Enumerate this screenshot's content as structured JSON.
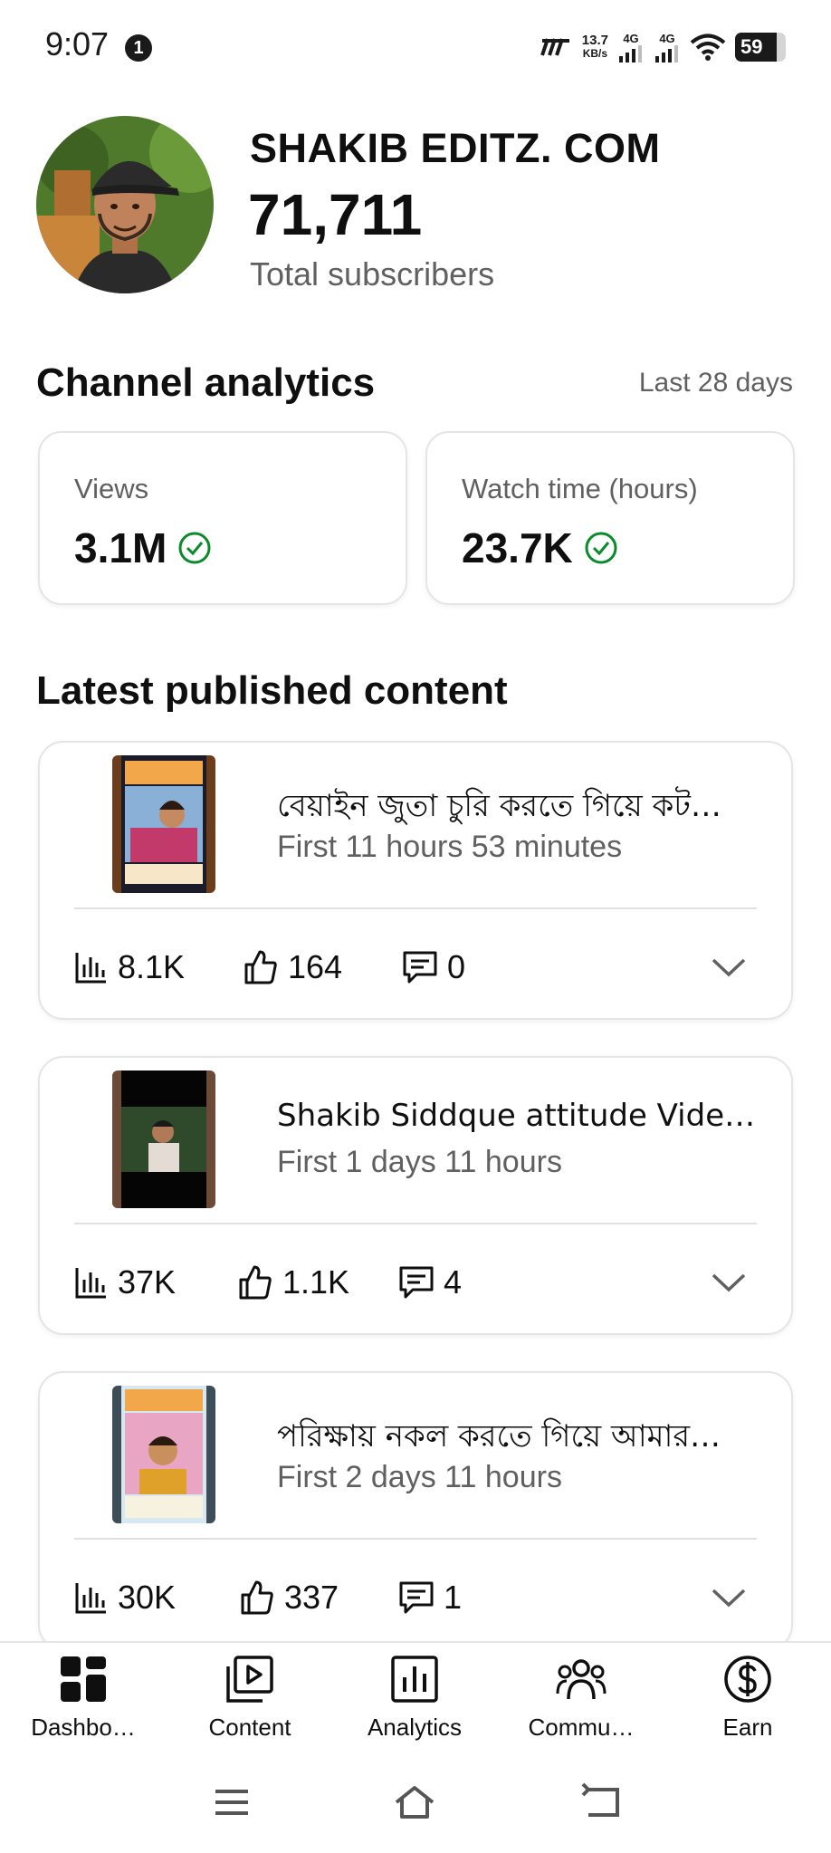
{
  "status_bar": {
    "time": "9:07",
    "notification_count": "1",
    "net_speed_value": "13.7",
    "net_speed_unit": "KB/s",
    "signal1_label": "4G",
    "signal2_label": "4G",
    "battery_level": "59"
  },
  "channel": {
    "name": "SHAKIB EDITZ. COM",
    "subscribers": "71,711",
    "subscribers_label": "Total subscribers"
  },
  "analytics": {
    "title": "Channel analytics",
    "range": "Last 28 days",
    "views_label": "Views",
    "views_value": "3.1M",
    "watch_label": "Watch time (hours)",
    "watch_value": "23.7K",
    "status_color": "#0a8a2a"
  },
  "latest": {
    "title": "Latest published content",
    "items": [
      {
        "title": "বেয়াইন জুতা চুরি করতে গিয়ে কট…",
        "subtitle": "First 11 hours 53 minutes",
        "views": "8.1K",
        "likes": "164",
        "comments": "0"
      },
      {
        "title": "Shakib Siddque attitude Vide…",
        "subtitle": "First 1 days 11 hours",
        "views": "37K",
        "likes": "1.1K",
        "comments": "4"
      },
      {
        "title": "পরিক্ষায় নকল করতে গিয়ে আমার…",
        "subtitle": "First 2 days 11 hours",
        "views": "30K",
        "likes": "337",
        "comments": "1"
      }
    ]
  },
  "bottom_nav": {
    "items": [
      {
        "label": "Dashbo…",
        "icon": "dashboard-icon"
      },
      {
        "label": "Content",
        "icon": "content-icon"
      },
      {
        "label": "Analytics",
        "icon": "analytics-icon"
      },
      {
        "label": "Commu…",
        "icon": "community-icon"
      },
      {
        "label": "Earn",
        "icon": "earn-icon"
      }
    ]
  }
}
